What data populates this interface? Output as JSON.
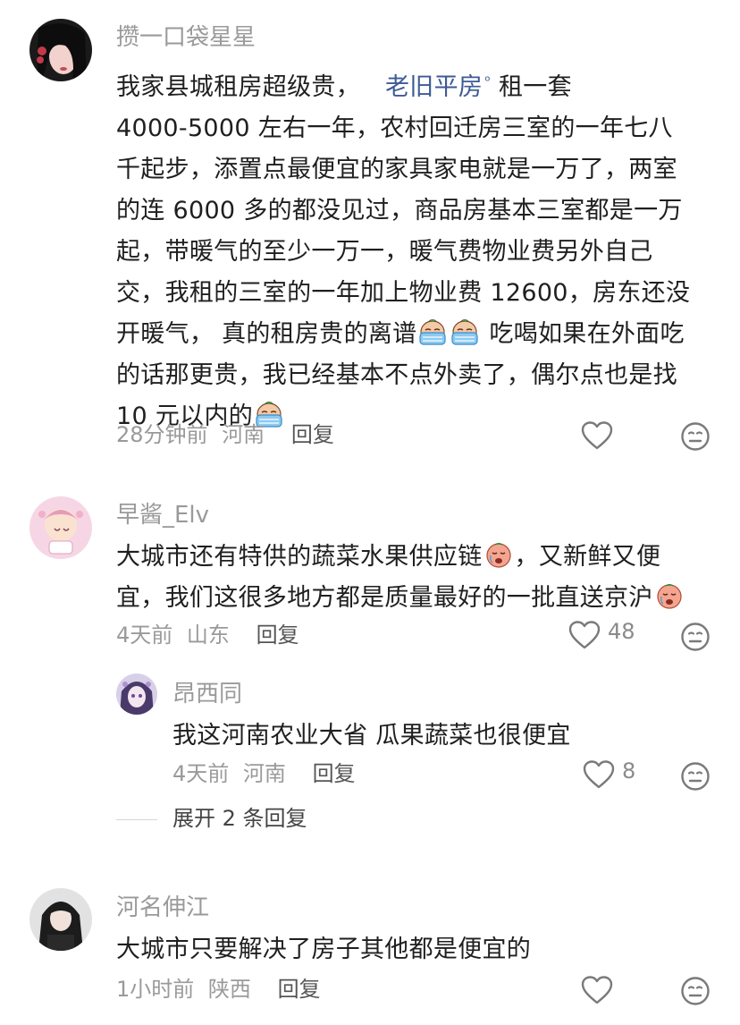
{
  "comments": [
    {
      "username": "攒一口袋星星",
      "text_before_link": "我家县城租房超级贵，",
      "link": "老旧平房",
      "text_after_link_line1": " 租一套",
      "lines": [
        "4000-5000 左右一年，农村回迁房三室的一年七八",
        "千起步，添置点最便宜的家具家电就是一万了，两室",
        "的连 6000 多的都没见过，商品房基本三室都是一万",
        "起，带暖气的至少一万一，暖气费物业费另外自己",
        "交，我租的三室的一年加上物业费 12600，房东还没"
      ],
      "line7_a": "开暖气， 真的租房贵的离谱",
      "line7_b": " 吃喝如果在外面吃",
      "line8": "的话那更贵，我已经基本不点外卖了，偶尔点也是找",
      "line9": "10 元以内的",
      "time": "28分钟前",
      "location": "河南",
      "reply_label": "回复",
      "likes": ""
    },
    {
      "username": "早酱_Elv",
      "line1": "大城市还有特供的蔬菜水果供应链",
      "line1_b": "，又新鲜又便",
      "line2": "宜，我们这很多地方都是质量最好的一批直送京沪",
      "time": "4天前",
      "location": "山东",
      "reply_label": "回复",
      "likes": "48"
    },
    {
      "username": "昂西同",
      "text": "我这河南农业大省 瓜果蔬菜也很便宜",
      "time": "4天前",
      "location": "河南",
      "reply_label": "回复",
      "likes": "8"
    },
    {
      "username": "河名伸江",
      "text": "大城市只要解决了房子其他都是便宜的",
      "time": "1小时前",
      "location": "陕西",
      "reply_label": "回复",
      "likes": ""
    }
  ],
  "expand_replies": "展开 2 条回复",
  "icons": {
    "search_mark": "ᵒ",
    "like": "heart-outline-icon",
    "dislike": "meh-face-icon",
    "crying_emoji": "crying-emoji",
    "sad_emoji": "sad-emoji"
  },
  "colors": {
    "link": "#3d5a96",
    "muted": "#9a9a9a"
  }
}
